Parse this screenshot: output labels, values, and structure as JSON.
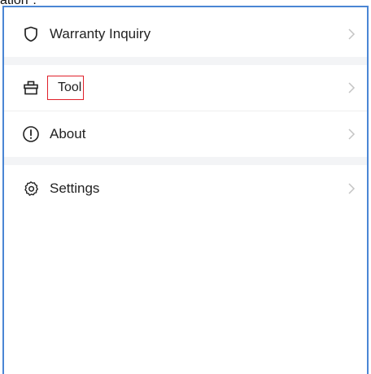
{
  "fragment": "ation\".",
  "menu": {
    "items": [
      {
        "label": "Warranty Inquiry",
        "icon": "shield-icon"
      },
      {
        "label": "Tool",
        "icon": "toolbox-icon"
      },
      {
        "label": "About",
        "icon": "info-circle-icon"
      },
      {
        "label": "Settings",
        "icon": "gear-icon"
      }
    ]
  },
  "colors": {
    "frame_border": "#4a86d4",
    "highlight": "#e0202a",
    "section_gap": "#f3f4f6"
  }
}
